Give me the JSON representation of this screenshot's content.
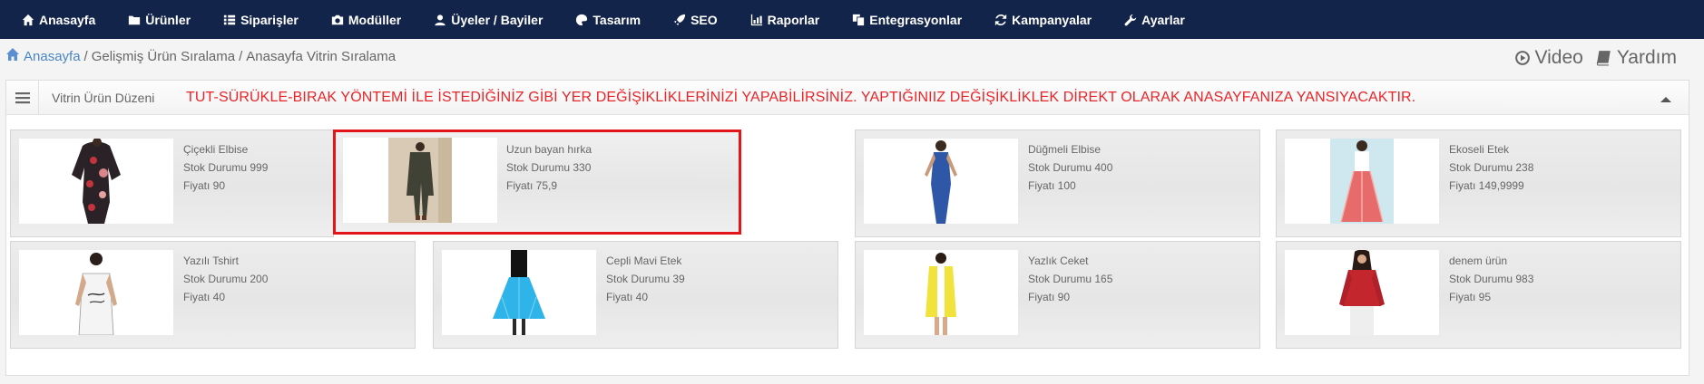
{
  "nav": {
    "items": [
      {
        "label": "Anasayfa",
        "icon": "home-icon"
      },
      {
        "label": "Ürünler",
        "icon": "folder-icon"
      },
      {
        "label": "Siparişler",
        "icon": "list-icon"
      },
      {
        "label": "Modüller",
        "icon": "camera-icon"
      },
      {
        "label": "Üyeler / Bayiler",
        "icon": "user-icon"
      },
      {
        "label": "Tasarım",
        "icon": "palette-icon"
      },
      {
        "label": "SEO",
        "icon": "rocket-icon"
      },
      {
        "label": "Raporlar",
        "icon": "chart-icon"
      },
      {
        "label": "Entegrasyonlar",
        "icon": "copy-icon"
      },
      {
        "label": "Kampanyalar",
        "icon": "refresh-icon"
      },
      {
        "label": "Ayarlar",
        "icon": "wrench-icon"
      }
    ]
  },
  "breadcrumb": {
    "home": "Anasayfa",
    "level1": "Gelişmiş Ürün Sıralama",
    "level2": "Anasayfa Vitrin Sıralama",
    "separator": "/"
  },
  "help": {
    "video": "Video",
    "help": "Yardım"
  },
  "panel": {
    "title": "Vitrin Ürün Düzeni",
    "notice": "TUT-SÜRÜKLE-BIRAK YÖNTEMİ İLE İSTEDİĞİNİZ GİBİ YER DEĞİŞİKLİKLERİNİZİ YAPABİLİRSİNİZ. YAPTIĞINIIZ DEĞİŞİKLİKLEK DİREKT OLARAK ANASAYFANIZA YANSIYACAKTIR."
  },
  "products": [
    {
      "name": "Çiçekli Elbise",
      "stock": "Stok Durumu 999",
      "price": "Fiyatı 90",
      "selected": false
    },
    {
      "name": "Uzun bayan hırka",
      "stock": "Stok Durumu 330",
      "price": "Fiyatı 75,9",
      "selected": true
    },
    {
      "name": "Düğmeli Elbise",
      "stock": "Stok Durumu 400",
      "price": "Fiyatı 100",
      "selected": false
    },
    {
      "name": "Ekoseli Etek",
      "stock": "Stok Durumu 238",
      "price": "Fiyatı 149,9999",
      "selected": false
    },
    {
      "name": "Yazılı Tshirt",
      "stock": "Stok Durumu 200",
      "price": "Fiyatı 40",
      "selected": false
    },
    {
      "name": "Cepli Mavi Etek",
      "stock": "Stok Durumu 39",
      "price": "Fiyatı 40",
      "selected": false
    },
    {
      "name": "Yazlık Ceket",
      "stock": "Stok Durumu 165",
      "price": "Fiyatı 90",
      "selected": false
    },
    {
      "name": "denem ürün",
      "stock": "Stok Durumu 983",
      "price": "Fiyatı 95",
      "selected": false
    }
  ],
  "colors": {
    "nav_bg": "#13244a",
    "link": "#4a86c8",
    "notice": "#e8262a",
    "selected_border": "#e3151a"
  }
}
